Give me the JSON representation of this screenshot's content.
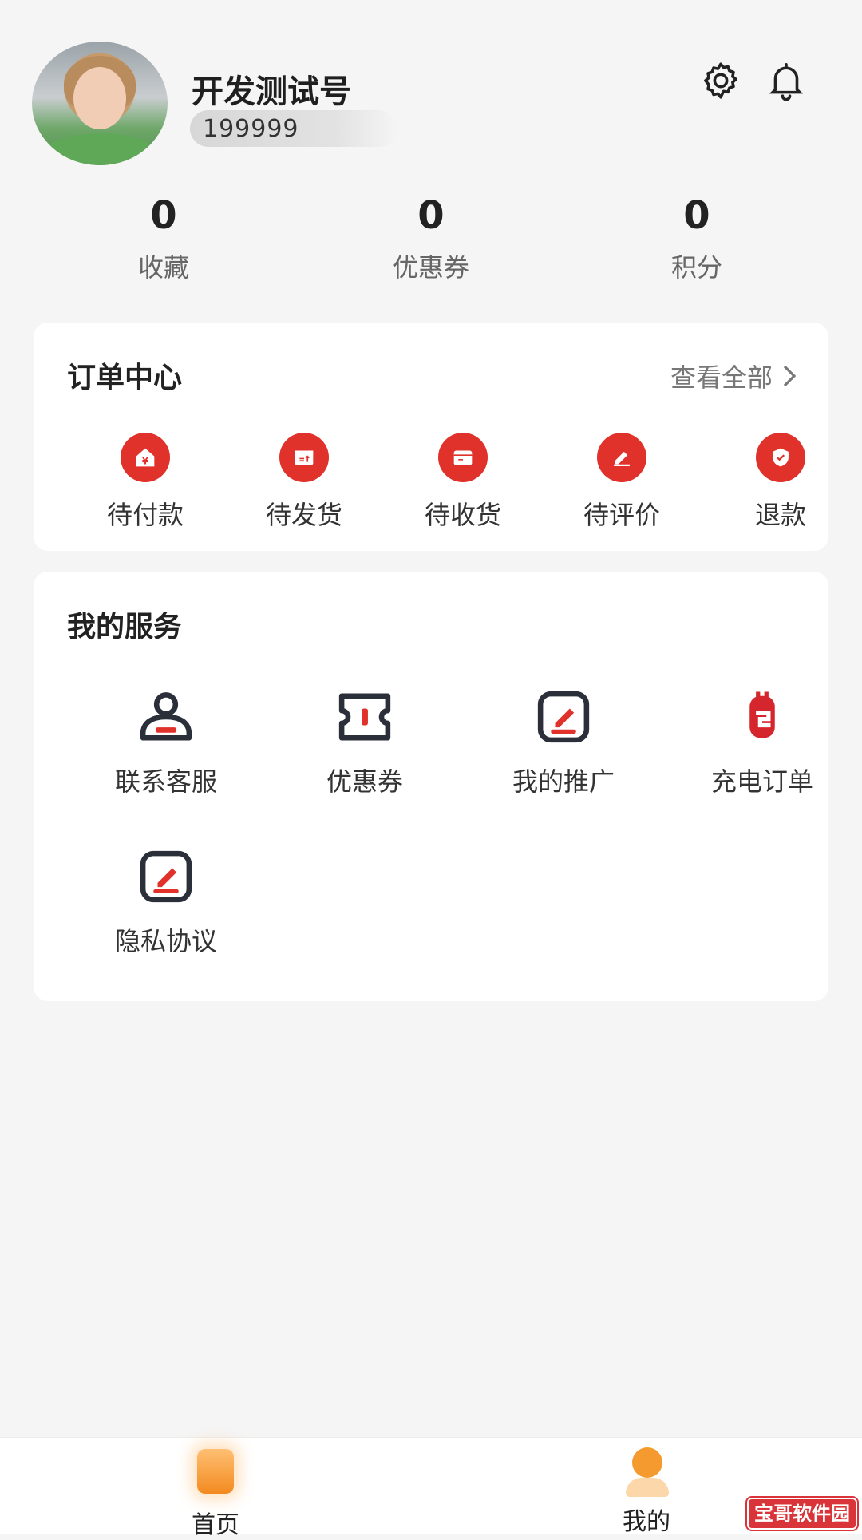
{
  "profile": {
    "username": "开发测试号",
    "phone": "199999"
  },
  "header_icons": {
    "settings": "gear-icon",
    "notifications": "bell-icon"
  },
  "stats": [
    {
      "value": "0",
      "label": "收藏"
    },
    {
      "value": "0",
      "label": "优惠券"
    },
    {
      "value": "0",
      "label": "积分"
    }
  ],
  "orders": {
    "title": "订单中心",
    "view_all": "查看全部",
    "items": [
      {
        "label": "待付款",
        "icon": "wallet-icon"
      },
      {
        "label": "待发货",
        "icon": "ship-box-icon"
      },
      {
        "label": "待收货",
        "icon": "receive-box-icon"
      },
      {
        "label": "待评价",
        "icon": "review-pen-icon"
      },
      {
        "label": "退款",
        "icon": "refund-shield-icon"
      }
    ]
  },
  "services": {
    "title": "我的服务",
    "items": [
      {
        "label": "联系客服",
        "icon": "customer-service-icon"
      },
      {
        "label": "优惠券",
        "icon": "coupon-icon"
      },
      {
        "label": "我的推广",
        "icon": "edit-square-icon"
      },
      {
        "label": "充电订单",
        "icon": "charging-plug-icon"
      },
      {
        "label": "隐私协议",
        "icon": "edit-square-icon"
      }
    ]
  },
  "tabbar": {
    "items": [
      {
        "label": "首页",
        "icon": "home-icon"
      },
      {
        "label": "我的",
        "icon": "user-icon"
      }
    ]
  },
  "watermark": "宝哥软件园",
  "colors": {
    "accent_red": "#e0312b",
    "tab_orange": "#f49a2f"
  }
}
